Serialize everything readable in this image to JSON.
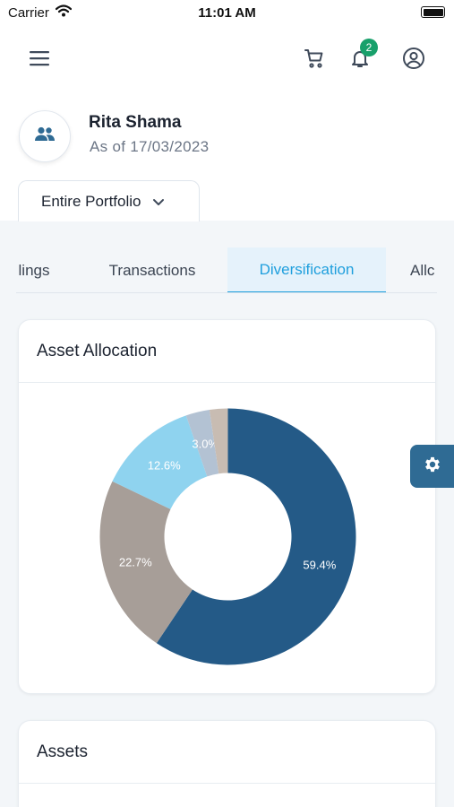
{
  "status_bar": {
    "carrier": "Carrier",
    "time": "11:01 AM"
  },
  "header": {
    "menu_icon": "hamburger-menu-icon",
    "cart_icon": "cart-icon",
    "bell_icon": "bell-icon",
    "notification_count": "2",
    "profile_icon": "user-circle-icon"
  },
  "profile": {
    "avatar_icon": "people-icon",
    "name": "Rita Shama",
    "as_of": "As of 17/03/2023"
  },
  "portfolio_selector": {
    "value": "Entire Portfolio",
    "icon": "chevron-down-icon"
  },
  "tabs": [
    {
      "label": "lings",
      "active": false
    },
    {
      "label": "Transactions",
      "active": false
    },
    {
      "label": "Diversification",
      "active": true
    },
    {
      "label": "Allc",
      "active": false
    }
  ],
  "asset_allocation": {
    "title": "Asset Allocation"
  },
  "assets": {
    "title": "Assets"
  },
  "settings_icon": "gear-icon",
  "colors": {
    "accent": "#1f9fdd",
    "navy": "#245a87",
    "badge": "#18a06b",
    "settings_tab": "#2f6b94"
  },
  "chart_data": {
    "type": "pie",
    "title": "",
    "values": [
      59.4,
      22.7,
      12.6,
      3.0,
      2.3
    ],
    "labels": [
      "59.4%",
      "22.7%",
      "12.6%",
      "3.0%",
      ""
    ],
    "colors": [
      "#245a87",
      "#a79e98",
      "#8fd3ef",
      "#b3c2d3",
      "#c8bcb2"
    ],
    "donut": true
  }
}
